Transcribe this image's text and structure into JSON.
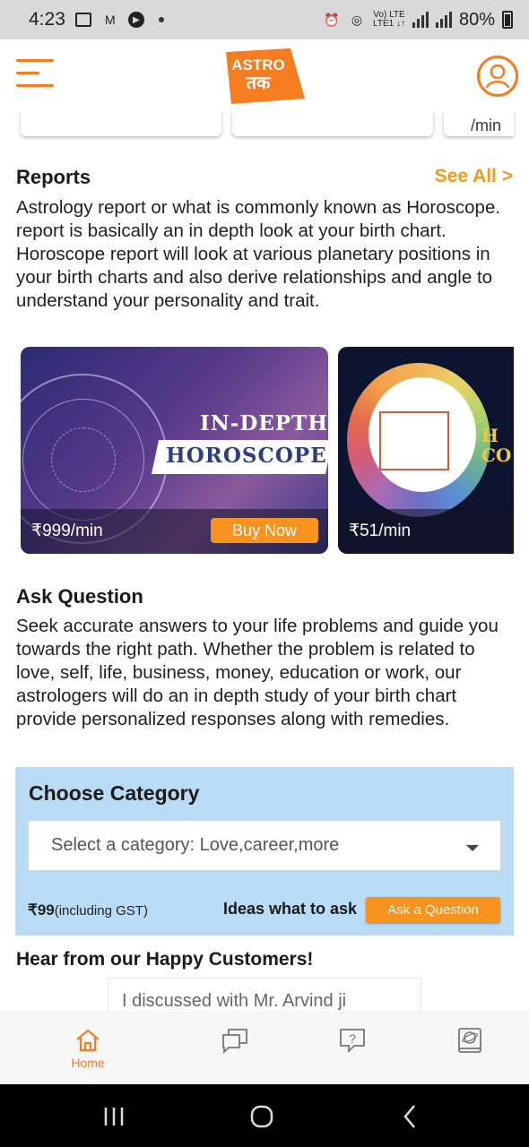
{
  "status_bar": {
    "time": "4:23",
    "network": "Vo) LTE\nLTE1",
    "battery": "80%"
  },
  "header": {
    "logo_line1": "ASTRO",
    "logo_line2": "तक"
  },
  "top_cards": {
    "price_fragment": "/min"
  },
  "reports": {
    "title": "Reports",
    "see_all": "See All >",
    "description": "Astrology report or what is commonly known as Horoscope. report is basically an in depth look at your birth chart. Horoscope report will look at various planetary positions in your birth charts and also derive relationships and angle to understand your personality and trait.",
    "cards": [
      {
        "line1": "IN-DEPTH",
        "line2": "HOROSCOPE",
        "price": "₹999/min",
        "button": "Buy Now"
      },
      {
        "line1": "H",
        "line2": "CO",
        "price": "₹51/min"
      }
    ]
  },
  "ask_question": {
    "title": "Ask Question",
    "description": "Seek accurate answers to your life problems and guide you towards the right path. Whether the problem is related to love, self, life, business, money, education or work, our astrologers will do an in depth study of your birth chart provide personalized responses along with remedies."
  },
  "category": {
    "title": "Choose Category",
    "placeholder": "Select a category: Love,career,more",
    "price": "₹99",
    "price_note": "(including GST)",
    "ideas": "Ideas what to ask",
    "ask_button": "Ask a Question"
  },
  "testimonials": {
    "title": "Hear from our Happy Customers!",
    "snippet": "I discussed with Mr. Arvind ji"
  },
  "bottom_nav": {
    "home": "Home"
  },
  "colors": {
    "accent": "#f57c1f",
    "category_bg": "#b9dbf5"
  }
}
